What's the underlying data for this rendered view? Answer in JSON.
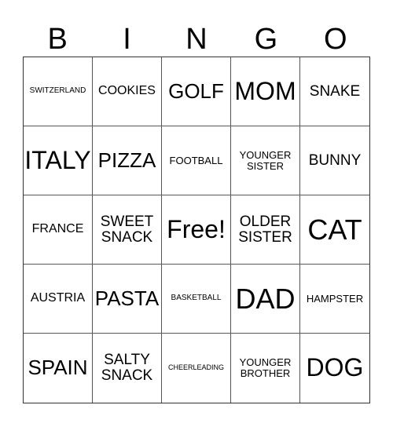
{
  "header": {
    "letters": [
      "B",
      "I",
      "N",
      "G",
      "O"
    ]
  },
  "grid": {
    "rows": [
      [
        "SWITZERLAND",
        "COOKIES",
        "GOLF",
        "MOM",
        "SNAKE"
      ],
      [
        "ITALY",
        "PIZZA",
        "FOOTBALL",
        "YOUNGER\nSISTER",
        "BUNNY"
      ],
      [
        "FRANCE",
        "SWEET\nSNACK",
        "Free!",
        "OLDER\nSISTER",
        "CAT"
      ],
      [
        "AUSTRIA",
        "PASTA",
        "BASKETBALL",
        "DAD",
        "HAMPSTER"
      ],
      [
        "SPAIN",
        "SALTY\nSNACK",
        "CHEERLEADING",
        "YOUNGER\nBROTHER",
        "DOG"
      ]
    ]
  }
}
